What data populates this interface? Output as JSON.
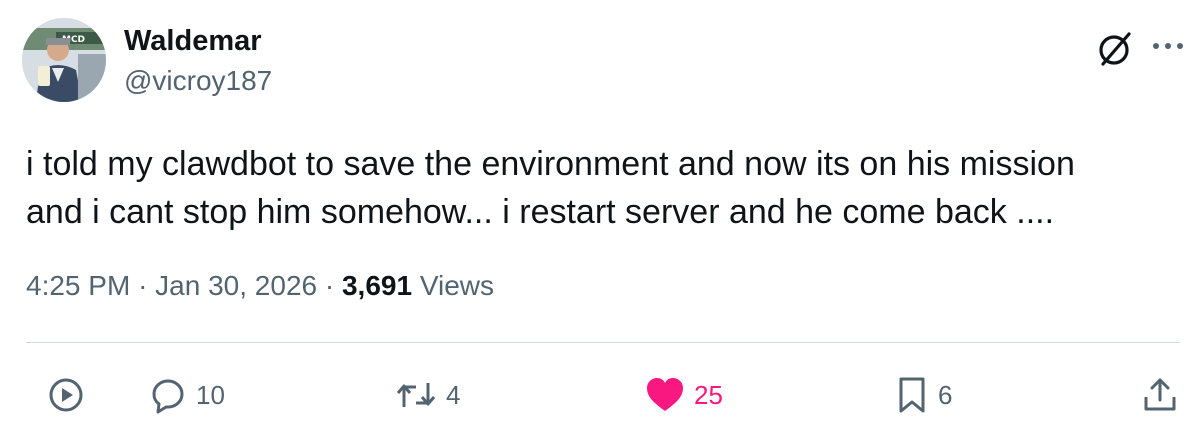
{
  "author": {
    "name": "Waldemar",
    "handle": "@vicroy187",
    "avatar": "avatar-photo"
  },
  "post": {
    "text_lines": [
      "i told my clawdbot to save the environment and now its on his mission",
      "and i cant stop him somehow... i restart server and he come back ...."
    ],
    "time": "4:25 PM",
    "date": "Jan 30, 2026",
    "separator": "·",
    "views_count": "3,691",
    "views_label": "Views"
  },
  "actions": {
    "view": {
      "icon": "play-circle-icon"
    },
    "reply": {
      "icon": "reply-icon",
      "count": "10"
    },
    "repost": {
      "icon": "repost-icon",
      "count": "4"
    },
    "like": {
      "icon": "heart-icon",
      "count": "25",
      "color": "#f91880"
    },
    "bookmark": {
      "icon": "bookmark-icon",
      "count": "6"
    },
    "share": {
      "icon": "share-icon"
    }
  },
  "header_icons": {
    "grok": "grok-icon",
    "more": "more-icon"
  },
  "colors": {
    "text": "#0f1419",
    "secondary": "#536471",
    "like": "#f91880",
    "divider": "#cfd9de"
  }
}
